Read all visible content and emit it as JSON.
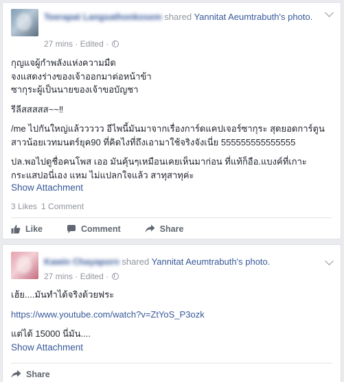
{
  "post1": {
    "author": "Teerapat Langsathonkosem",
    "shared_word": "shared",
    "target_name": "Yannitat Aeumtrabuth",
    "target_suffix": "'s",
    "object": "photo.",
    "time": "27 mins",
    "separator": "·",
    "edited": "Edited",
    "lines": [
      "กุญแจผู้กำพลังแห่งความมืด",
      "จงแสดงร่างของเจ้าออกมาต่อหน้าข้า",
      "ซากุระผู้เป็นนายของเจ้าขอบัญชา",
      "รีลีสสสสส~~‼",
      "/me ไปกันใหญ่แล้ววววว อีไพนี้มันมาจากเรื่องการ์ดแคปเจอร์ซากุระ สุดยอดการ์ตูนสาวน้อยเวทมนตร์ยุค90 ที่คิดไงที่ถึงเอามาใช้จริงจังเนี่ย 555555555555555",
      "ปล.พอไปดูชื่อคนโพส เออ มันคุ้นๆเหมือนเคยเห็นมาก่อน ที่แท้ก็อือ.แบงค์ที่เกาะกระแสปอนี่เอง แหม ไม่แปลกใจแล้ว สาทุสาทุค่ะ"
    ],
    "show_attachment": "Show Attachment",
    "likes": "3 Likes",
    "comments": "1 Comment",
    "actions": {
      "like": "Like",
      "comment": "Comment",
      "share": "Share"
    }
  },
  "post2": {
    "author": "Kawin Chayaporn",
    "shared_word": "shared",
    "target_name": "Yannitat Aeumtrabuth",
    "target_suffix": "'s photo.",
    "time": "27 mins",
    "separator": "·",
    "edited": "Edited",
    "lines": [
      "เฮ้ย....มันทำได้จริงด้วยฟระ",
      "https://www.youtube.com/watch?v=ZtYoS_P3ozk",
      "แต่ได้ 15000 นี่มัน...."
    ],
    "show_attachment": "Show Attachment",
    "actions": {
      "share": "Share"
    }
  },
  "icons": {
    "globe": "globe-icon",
    "chevron": "chevron-down-icon",
    "like": "thumbs-up-icon",
    "comment": "speech-bubble-icon",
    "share": "share-arrow-icon"
  },
  "colors": {
    "link": "#365899",
    "muted": "#90949c",
    "text": "#1d2129",
    "background": "#e9ebee"
  }
}
